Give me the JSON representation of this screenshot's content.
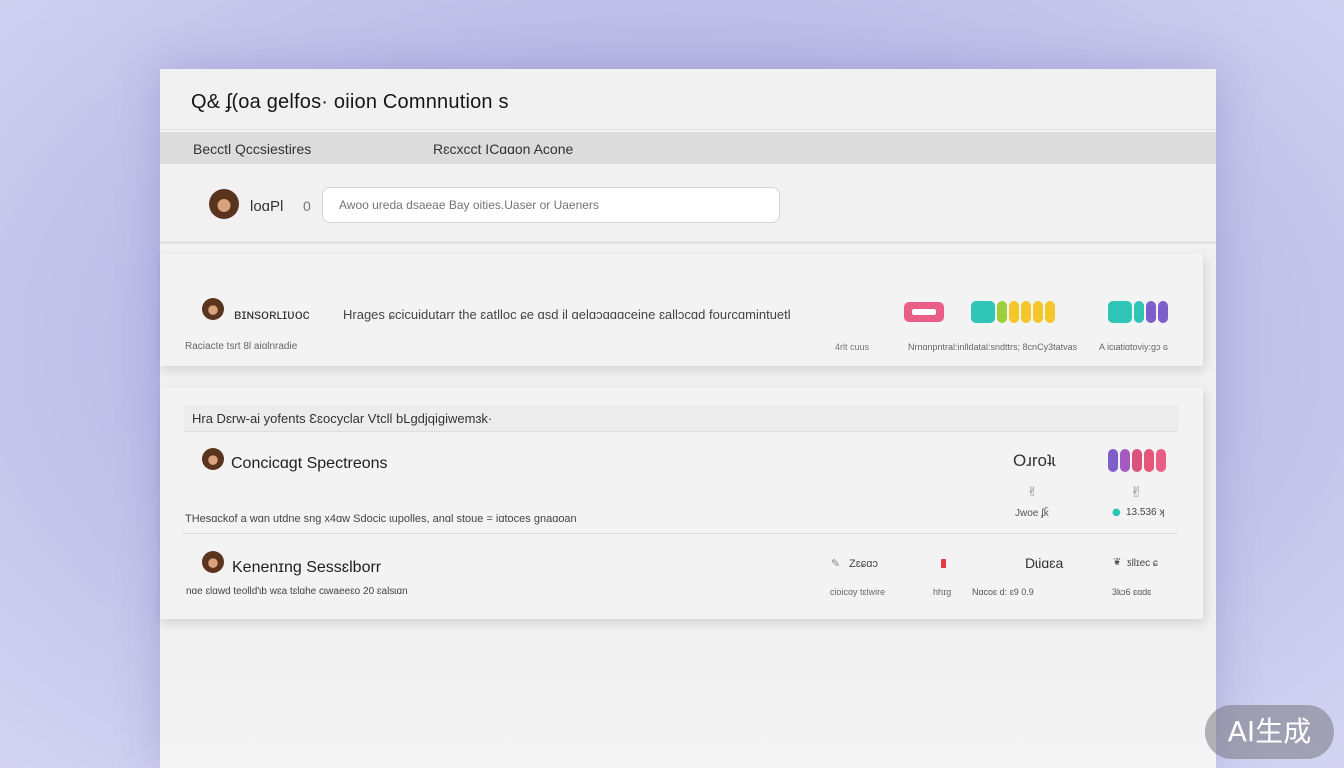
{
  "header": {
    "title": "Q& ʄ(oa gelfos· oiion Comnnution s"
  },
  "tabs": [
    {
      "label": "Becctl Qccsiestires"
    },
    {
      "label": "Rɛcxcct ICɑɑon Acone"
    }
  ],
  "composer": {
    "name": "loɑPl",
    "count": "0",
    "search_placeholder": "Awoo ureda dsaeae Bay oities.Uaser or Uaeners"
  },
  "post": {
    "author": "ʙɪɴsoʀʟɪʋoc",
    "text": "Hrages ɕcicuidutarr the ɛatlloc ɕe ɑsd il ɑelɑɔɑɑɑceine ɛallɔcɑd fouɾcɑmintuetl",
    "footer_left": "Raciacte tsrt 8l aiɑlnradie",
    "footer_meta1": "4rlt cuus",
    "footer_meta2": "Nrnɑnpntral:inlldatal:sndttrs; 8cnCy3tatvas",
    "footer_meta3": "A icɩatiɑtoviy:gɔ ɢ",
    "colors": {
      "pink": "#ea5e86",
      "teal": "#2ec4b6",
      "yellow": "#f5c62a",
      "purple": "#7e5ec8"
    }
  },
  "discussions": {
    "header": "Hra Dɛrw-ai yofents Ɛɛocyclar Vtcll bLgdjqigiwemɜk·",
    "items": [
      {
        "title": "Concicɑgt Spectreons",
        "description": "THesɑckof a wɑn utdne sng x4ɑw Sdocic ɩupolles, anɑl stoue = iɑtoces gnaɑoan",
        "label_right": "Oɹroʇɩ",
        "meta_a": "Jwoe ʄǩ",
        "meta_b": "13.536 ʞ"
      },
      {
        "title": "Kenenɪng Sessɛlborr",
        "description": "nɑe ɛlɑwd teolld'ɩb wɛa tɛlɑhe cɩwaeeɛo 20 ɛalsɩɑn",
        "m1": "Zɛɕɑɔ",
        "m1_sub": "cioicɑy tɛlwire",
        "m2_sub": "hhɪg",
        "m3": "Dɩiɑɛa",
        "m3_sub": "Nɑcoɛ d: ɛ9 0.9",
        "m4": "ƽllɪec ɕ",
        "m4_sub": "3lɩɔ6 ɛɑdɛ"
      }
    ]
  },
  "watermark": "AI生成"
}
